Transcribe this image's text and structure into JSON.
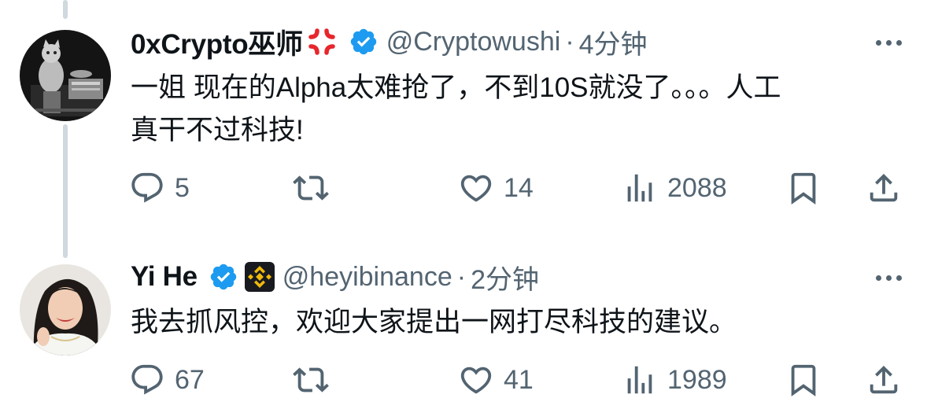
{
  "tweets": [
    {
      "author_name": "0xCrypto巫师",
      "name_emoji": "anger-symbol-icon",
      "handle": "@Cryptowushi",
      "separator": "·",
      "time": "4分钟",
      "text_line1": "一姐 现在的Alpha太难抢了，不到10S就没了。。。人工",
      "text_line2": "真干不过科技!",
      "replies": "5",
      "retweets": "",
      "likes": "14",
      "views": "2088"
    },
    {
      "author_name": "Yi He",
      "org_badge": "binance-icon",
      "handle": "@heyibinance",
      "separator": "·",
      "time": "2分钟",
      "text_line1": "我去抓风控，欢迎大家提出一网打尽科技的建议。",
      "replies": "67",
      "retweets": "",
      "likes": "41",
      "views": "1989"
    }
  ],
  "colors": {
    "verified": "#1d9bf0",
    "muted": "#536471",
    "text": "#0f1419",
    "thread_line": "#cfd9de",
    "anger": "#e8262c",
    "binance": "#f0b90b"
  }
}
